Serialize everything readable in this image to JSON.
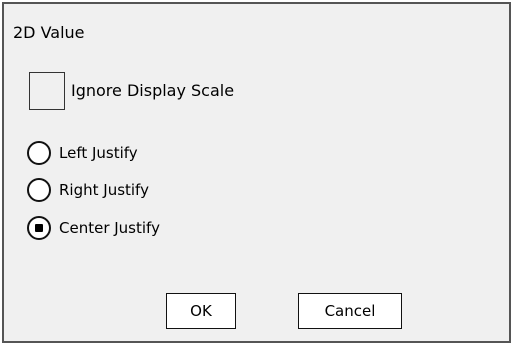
{
  "dialog": {
    "title": "2D Value",
    "ignore_display_scale": {
      "label": "Ignore Display Scale",
      "checked": false
    },
    "justify_options": [
      {
        "label": "Left Justify",
        "selected": false
      },
      {
        "label": "Right Justify",
        "selected": false
      },
      {
        "label": "Center Justify",
        "selected": true
      }
    ],
    "buttons": {
      "ok_label": "OK",
      "cancel_label": "Cancel"
    }
  }
}
